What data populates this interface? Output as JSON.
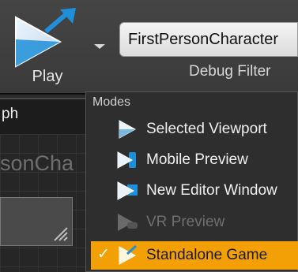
{
  "toolbar": {
    "play_label": "Play",
    "debug_filter_value": "FirstPersonCharacter",
    "debug_filter_label": "Debug Filter"
  },
  "background": {
    "graph_tab_label": "ph",
    "graph_title": "sonCha"
  },
  "modes_menu": {
    "header": "Modes",
    "items": [
      {
        "label": "Selected Viewport",
        "icon": "viewport-play-icon",
        "state": "normal"
      },
      {
        "label": "Mobile Preview",
        "icon": "mobile-play-icon",
        "state": "normal"
      },
      {
        "label": "New Editor Window",
        "icon": "window-play-icon",
        "state": "normal"
      },
      {
        "label": "VR Preview",
        "icon": "vr-play-icon",
        "state": "disabled"
      },
      {
        "label": "Standalone Game",
        "icon": "standalone-play-icon",
        "state": "selected"
      }
    ],
    "selected_check": "✓"
  },
  "colors": {
    "selected_highlight": "#f3a007",
    "play_blue": "#1e8fd8",
    "menu_bg": "#2e2e2e"
  }
}
